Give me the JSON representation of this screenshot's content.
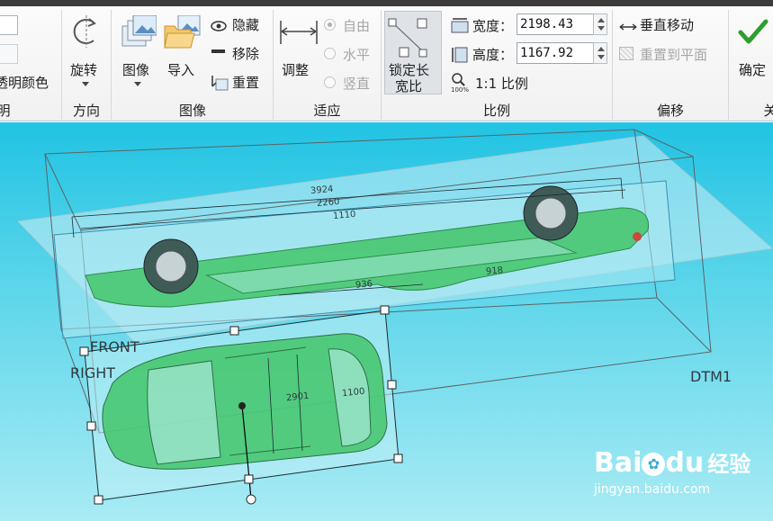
{
  "ribbon": {
    "transparency": {
      "label": "透明颜色",
      "group_label": "明"
    },
    "orientation": {
      "rotate_label": "旋转",
      "group_label": "方向"
    },
    "image": {
      "image_label": "图像",
      "import_label": "导入",
      "hide_label": "隐藏",
      "remove_label": "移除",
      "reset_label": "重置",
      "group_label": "图像"
    },
    "fit": {
      "adjust_label": "调整",
      "free_label": "自由",
      "horizontal_label": "水平",
      "vertical_label": "竖直",
      "group_label": "适应",
      "selected": "自由"
    },
    "ratio": {
      "lock_label_line1": "锁定长",
      "lock_label_line2": "宽比",
      "width_label": "宽度：",
      "width_value": "2198.43",
      "height_label": "高度：",
      "height_value": "1167.92",
      "one_to_one_label": "1:1 比例",
      "zoom_badge": "100%",
      "group_label": "比例"
    },
    "offset": {
      "vertical_move_label": "垂直移动",
      "reset_to_plane_label": "重置到平面",
      "group_label": "偏移"
    },
    "confirm": {
      "ok_label": "确定",
      "group_label": "关"
    }
  },
  "viewport": {
    "labels": {
      "front": "FRONT",
      "right": "RIGHT",
      "dtm": "DTM1"
    },
    "dimension_texts": [
      "3924",
      "2260",
      "1110",
      "936",
      "918",
      "2901",
      "1100"
    ],
    "watermark": {
      "brand": "Bai",
      "brand2": "du",
      "brand_cn": "经验",
      "url": "jingyan.baidu.com"
    }
  },
  "colors": {
    "accent": "#1f9bd6",
    "car_body": "#43c56a",
    "viewport_top": "#21c3e3",
    "checkmark": "#2e9e2e"
  }
}
